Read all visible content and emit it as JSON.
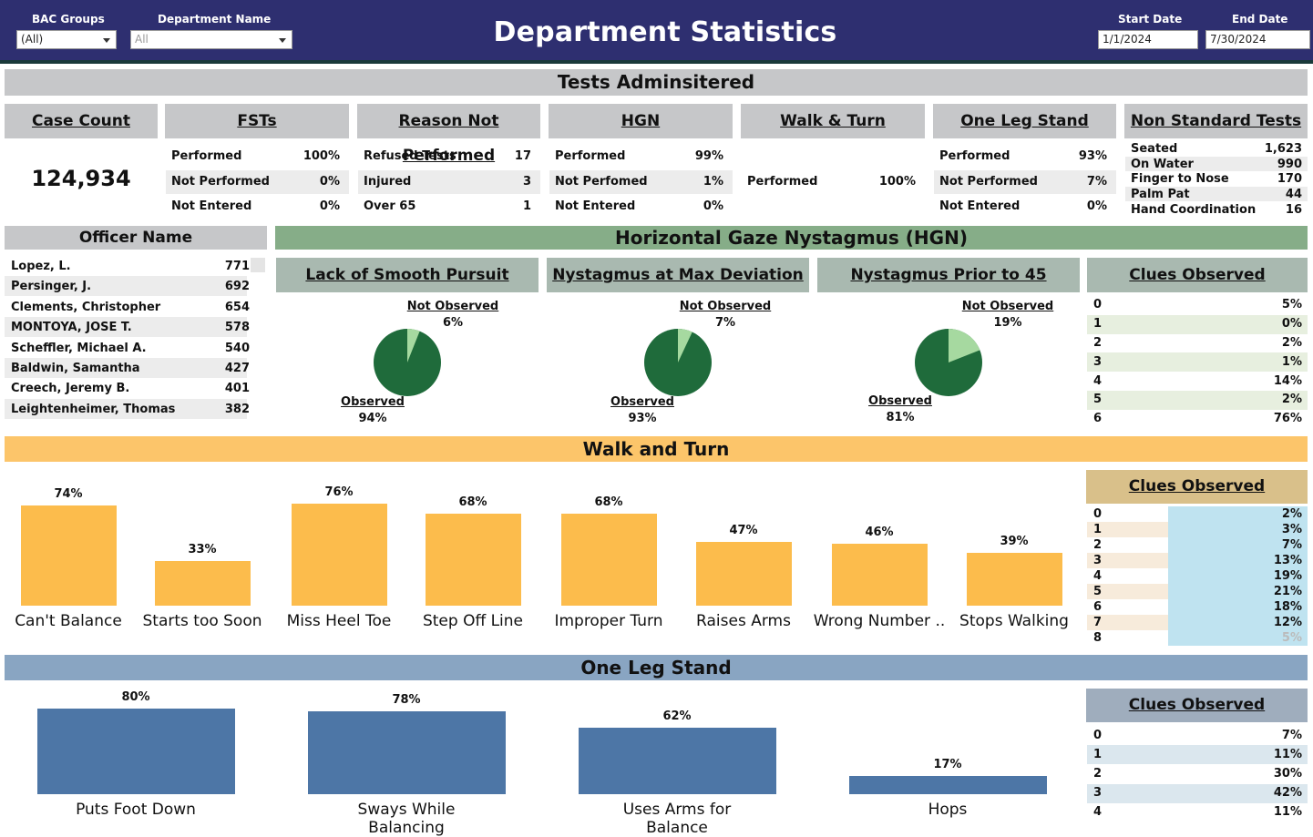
{
  "header": {
    "title": "Department Statistics",
    "bac_label": "BAC Groups",
    "bac_value": "(All)",
    "dept_label": "Department Name",
    "dept_value": "All",
    "start_label": "Start Date",
    "start_value": "1/1/2024",
    "end_label": "End Date",
    "end_value": "7/30/2024"
  },
  "tests_administered": {
    "title": "Tests Adminsitered",
    "case_count": {
      "heading": "Case Count",
      "value": "124,934"
    },
    "fsts": {
      "heading": "FSTs",
      "rows": [
        [
          "Performed",
          "100%"
        ],
        [
          "Not Performed",
          "0%"
        ],
        [
          "Not Entered",
          "0%"
        ]
      ]
    },
    "reason": {
      "heading": "Reason Not Performed",
      "rows": [
        [
          "Refused Tests",
          "17"
        ],
        [
          "Injured",
          "3"
        ],
        [
          "Over 65",
          "1"
        ]
      ]
    },
    "hgn": {
      "heading": "HGN",
      "rows": [
        [
          "Performed",
          "99%"
        ],
        [
          "Not Perfomed",
          "1%"
        ],
        [
          "Not Entered",
          "0%"
        ]
      ]
    },
    "walk_turn": {
      "heading": "Walk & Turn",
      "rows": [
        [
          "Performed",
          "100%"
        ]
      ]
    },
    "one_leg": {
      "heading": "One Leg Stand",
      "rows": [
        [
          "Performed",
          "93%"
        ],
        [
          "Not Performed",
          "7%"
        ],
        [
          "Not Entered",
          "0%"
        ]
      ]
    },
    "non_standard": {
      "heading": "Non Standard Tests",
      "rows": [
        [
          "Seated",
          "1,623"
        ],
        [
          "On Water",
          "990"
        ],
        [
          "Finger to Nose",
          "170"
        ],
        [
          "Palm Pat",
          "44"
        ],
        [
          "Hand Coordination",
          "16"
        ]
      ]
    }
  },
  "officers": {
    "heading": "Officer Name",
    "rows": [
      [
        "Lopez, L.",
        "771"
      ],
      [
        "Persinger, J.",
        "692"
      ],
      [
        "Clements, Christopher",
        "654"
      ],
      [
        "MONTOYA, JOSE T.",
        "578"
      ],
      [
        "Scheffler, Michael A.",
        "540"
      ],
      [
        "Baldwin, Samantha",
        "427"
      ],
      [
        "Creech, Jeremy B.",
        "401"
      ],
      [
        "Leightenheimer, Thomas",
        "382"
      ]
    ]
  },
  "hgn_section": {
    "title": "Horizontal Gaze Nystagmus (HGN)",
    "pies": [
      {
        "heading": "Lack of Smooth Pursuit",
        "not_observed_label": "Not Observed",
        "not_observed": 6,
        "not_observed_text": "6%",
        "observed_label": "Observed",
        "observed_text": "94%"
      },
      {
        "heading": "Nystagmus at Max Deviation",
        "not_observed_label": "Not Observed",
        "not_observed": 7,
        "not_observed_text": "7%",
        "observed_label": "Observed",
        "observed_text": "93%"
      },
      {
        "heading": "Nystagmus Prior to 45",
        "not_observed_label": "Not Observed",
        "not_observed": 19,
        "not_observed_text": "19%",
        "observed_label": "Observed",
        "observed_text": "81%"
      }
    ],
    "clues": {
      "heading": "Clues Observed",
      "rows": [
        [
          "0",
          "5%"
        ],
        [
          "1",
          "0%"
        ],
        [
          "2",
          "2%"
        ],
        [
          "3",
          "1%"
        ],
        [
          "4",
          "14%"
        ],
        [
          "5",
          "2%"
        ],
        [
          "6",
          "76%"
        ]
      ]
    }
  },
  "walk_and_turn": {
    "title": "Walk and Turn",
    "clues": {
      "heading": "Clues Observed",
      "rows": [
        [
          "0",
          "2%"
        ],
        [
          "1",
          "3%"
        ],
        [
          "2",
          "7%"
        ],
        [
          "3",
          "13%"
        ],
        [
          "4",
          "19%"
        ],
        [
          "5",
          "21%"
        ],
        [
          "6",
          "18%"
        ],
        [
          "7",
          "12%"
        ],
        [
          "8",
          "5%"
        ]
      ]
    }
  },
  "one_leg_stand": {
    "title": "One Leg Stand",
    "clues": {
      "heading": "Clues Observed",
      "rows": [
        [
          "0",
          "7%"
        ],
        [
          "1",
          "11%"
        ],
        [
          "2",
          "30%"
        ],
        [
          "3",
          "42%"
        ],
        [
          "4",
          "11%"
        ]
      ]
    }
  },
  "colors": {
    "header_bg": "#2e2f70",
    "hgn_green": "#1f6b3b",
    "hgn_light": "#a6d9a0",
    "walk_turn": "#fcbc4c",
    "one_leg": "#4d76a6"
  },
  "chart_data": [
    {
      "type": "bar",
      "title": "Walk and Turn",
      "categories": [
        "Can't Balance",
        "Starts too Soon",
        "Miss Heel Toe",
        "Step Off Line",
        "Improper Turn",
        "Raises Arms",
        "Wrong Number ..",
        "Stops Walking"
      ],
      "values": [
        74,
        33,
        76,
        68,
        68,
        47,
        46,
        39
      ],
      "labels": [
        "74%",
        "33%",
        "76%",
        "68%",
        "68%",
        "47%",
        "46%",
        "39%"
      ],
      "ylim": [
        0,
        100
      ]
    },
    {
      "type": "bar",
      "title": "One Leg Stand",
      "categories": [
        "Puts Foot Down",
        "Sways While Balancing",
        "Uses Arms for Balance",
        "Hops"
      ],
      "values": [
        80,
        78,
        62,
        17
      ],
      "labels": [
        "80%",
        "78%",
        "62%",
        "17%"
      ],
      "ylim": [
        0,
        100
      ]
    }
  ]
}
